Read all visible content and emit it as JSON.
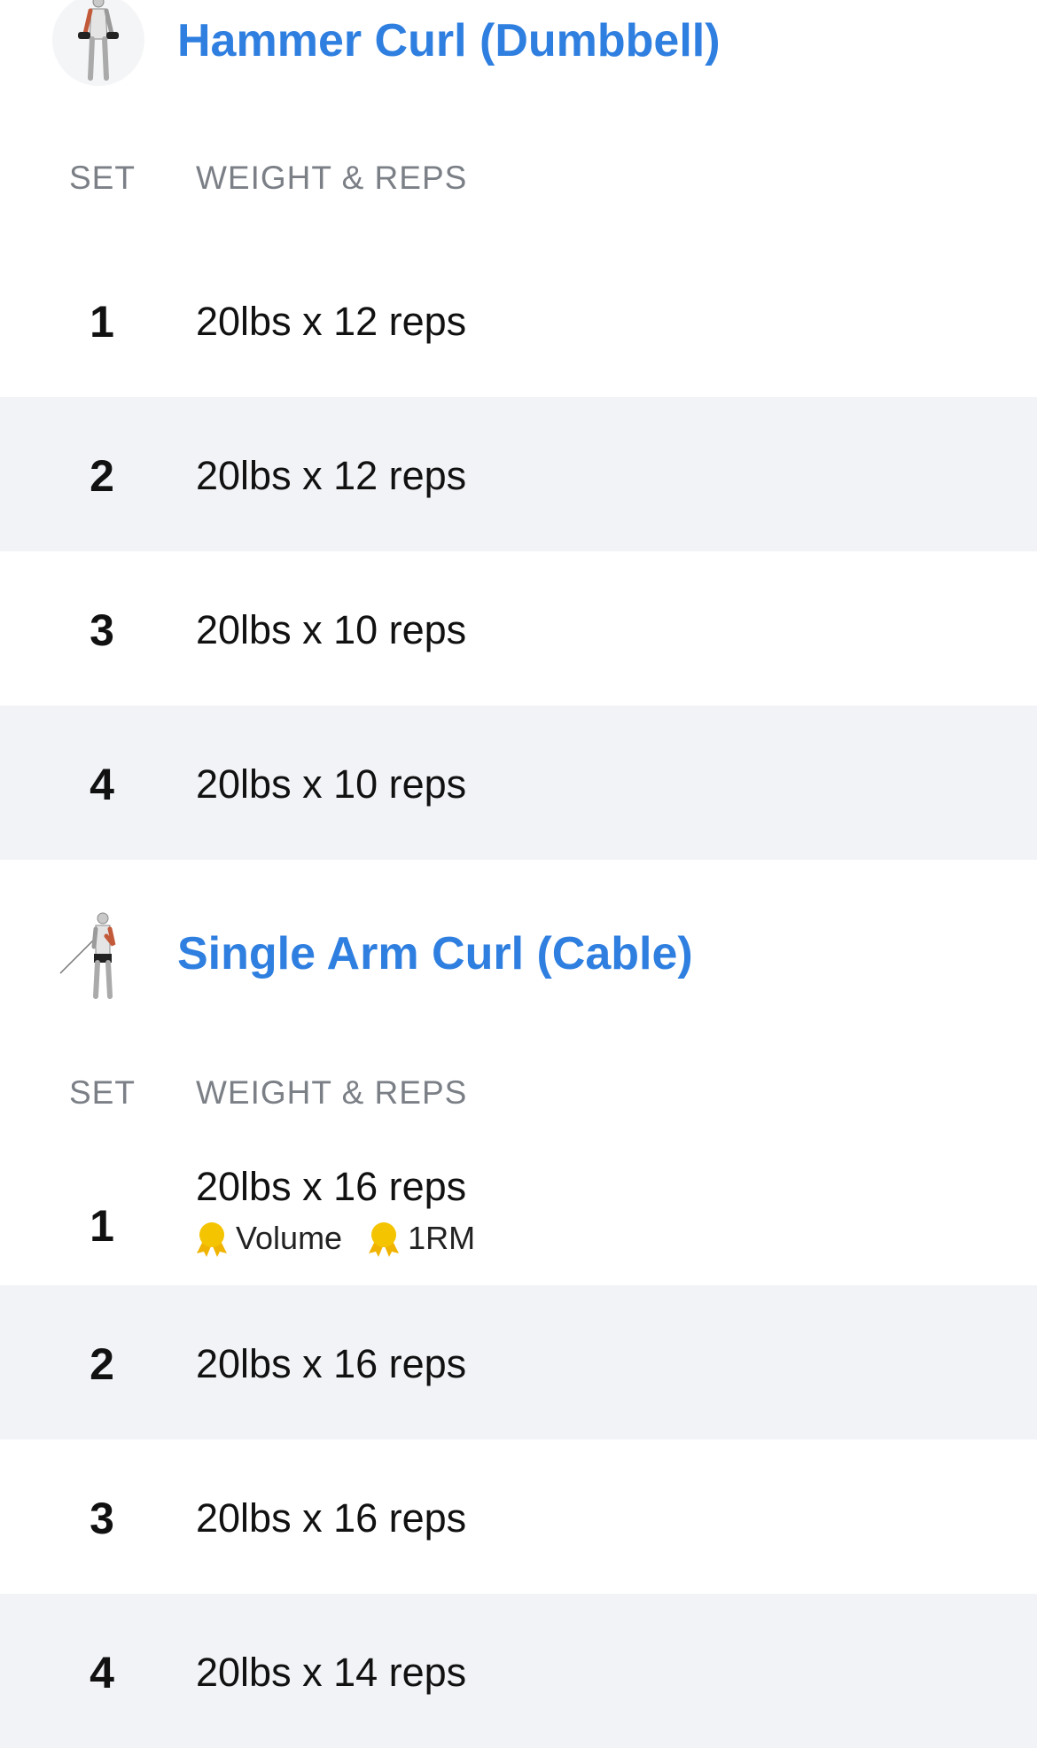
{
  "column_headers": {
    "set": "SET",
    "weight_reps": "WEIGHT & REPS"
  },
  "exercises": [
    {
      "title": "Hammer Curl (Dumbbell)",
      "thumbnail_icon": "dumbbell-figure-icon",
      "sets": [
        {
          "number": "1",
          "weight_reps": "20lbs x 12 reps"
        },
        {
          "number": "2",
          "weight_reps": "20lbs x 12 reps"
        },
        {
          "number": "3",
          "weight_reps": "20lbs x 10 reps"
        },
        {
          "number": "4",
          "weight_reps": "20lbs x 10 reps"
        }
      ]
    },
    {
      "title": "Single Arm Curl (Cable)",
      "thumbnail_icon": "cable-figure-icon",
      "sets": [
        {
          "number": "1",
          "weight_reps": "20lbs x 16 reps",
          "badges": [
            "Volume",
            "1RM"
          ]
        },
        {
          "number": "2",
          "weight_reps": "20lbs x 16 reps"
        },
        {
          "number": "3",
          "weight_reps": "20lbs x 16 reps"
        },
        {
          "number": "4",
          "weight_reps": "20lbs x 14 reps"
        }
      ]
    }
  ],
  "colors": {
    "title_accent": "#2f7fe0",
    "alt_row_bg": "#f2f3f7",
    "header_text": "#7b7f86",
    "medal": "#f5c400"
  }
}
